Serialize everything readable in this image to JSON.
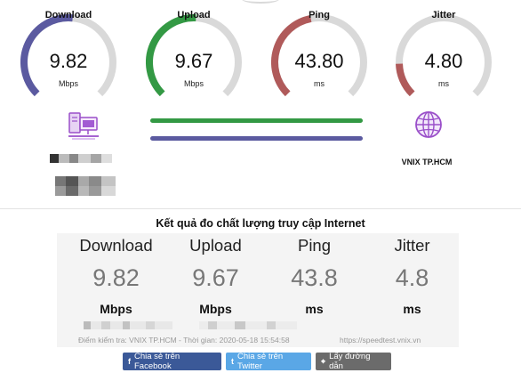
{
  "gauges": [
    {
      "id": "download",
      "title": "Download",
      "value": "9.82",
      "unit": "Mbps",
      "color": "#5b5aa0",
      "fill": 0.52
    },
    {
      "id": "upload",
      "title": "Upload",
      "value": "9.67",
      "unit": "Mbps",
      "color": "#339944",
      "fill": 0.51
    },
    {
      "id": "ping",
      "title": "Ping",
      "value": "43.80",
      "unit": "ms",
      "color": "#b05a5a",
      "fill": 0.46
    },
    {
      "id": "jitter",
      "title": "Jitter",
      "value": "4.80",
      "unit": "ms",
      "color": "#b05a5a",
      "fill": 0.16
    }
  ],
  "track_color": "#d9d9d9",
  "server": {
    "name": "VNIX TP.HCM"
  },
  "result": {
    "title": "Kết quả đo chất lượng truy cập Internet",
    "columns": [
      {
        "label": "Download",
        "value": "9.82",
        "unit": "Mbps"
      },
      {
        "label": "Upload",
        "value": "9.67",
        "unit": "Mbps"
      },
      {
        "label": "Ping",
        "value": "43.8",
        "unit": "ms"
      },
      {
        "label": "Jitter",
        "value": "4.8",
        "unit": "ms"
      }
    ],
    "footer_info": "Điểm kiểm tra: VNIX TP.HCM - Thời gian: 2020-05-18 15:54:58",
    "footer_url": "https://speedtest.vnix.vn"
  },
  "buttons": {
    "facebook": {
      "icon": "f",
      "label": "Chia sẻ trên Facebook"
    },
    "twitter": {
      "icon": "t",
      "label": "Chia sẻ trên Twitter"
    },
    "directions": {
      "icon": "⌖",
      "label": "Lấy đường dẫn"
    }
  },
  "icons": {
    "client": "server-computer-icon",
    "server": "globe-icon"
  }
}
